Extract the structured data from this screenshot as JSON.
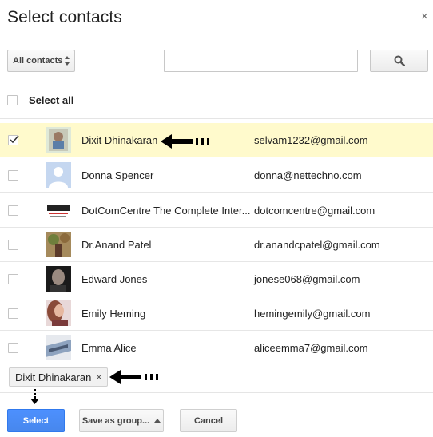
{
  "dialog": {
    "title": "Select contacts",
    "close_glyph": "×"
  },
  "toolbar": {
    "filter_label": "All contacts",
    "search_value": "",
    "search_icon": "magnifier-icon"
  },
  "select_all": {
    "label": "Select all",
    "checked": false
  },
  "contacts": [
    {
      "name": "Dixit Dhinakaran",
      "email": "selvam1232@gmail.com",
      "checked": true,
      "photo": "person-photo"
    },
    {
      "name": "Donna Spencer",
      "email": "donna@nettechno.com",
      "checked": false,
      "photo": "default-avatar"
    },
    {
      "name": "DotComCentre The Complete Inter...",
      "email": "dotcomcentre@gmail.com",
      "checked": false,
      "photo": "DotComCentre logo"
    },
    {
      "name": "Dr.Anand Patel",
      "email": "dr.anandcpatel@gmail.com",
      "checked": false,
      "photo": "outdoor-photo"
    },
    {
      "name": "Edward Jones",
      "email": "jonese068@gmail.com",
      "checked": false,
      "photo": "person-photo"
    },
    {
      "name": "Emily Heming",
      "email": "hemingemily@gmail.com",
      "checked": false,
      "photo": "person-photo"
    },
    {
      "name": "Emma Alice",
      "email": "aliceemma7@gmail.com",
      "checked": false,
      "photo": "text-graphic"
    }
  ],
  "selected_chip": {
    "label": "Dixit Dhinakaran",
    "remove_glyph": "×"
  },
  "buttons": {
    "select": "Select",
    "save_as_group": "Save as group...",
    "cancel": "Cancel"
  },
  "colors": {
    "selected_row": "#fffacc",
    "primary_button": "#4d90fe"
  }
}
